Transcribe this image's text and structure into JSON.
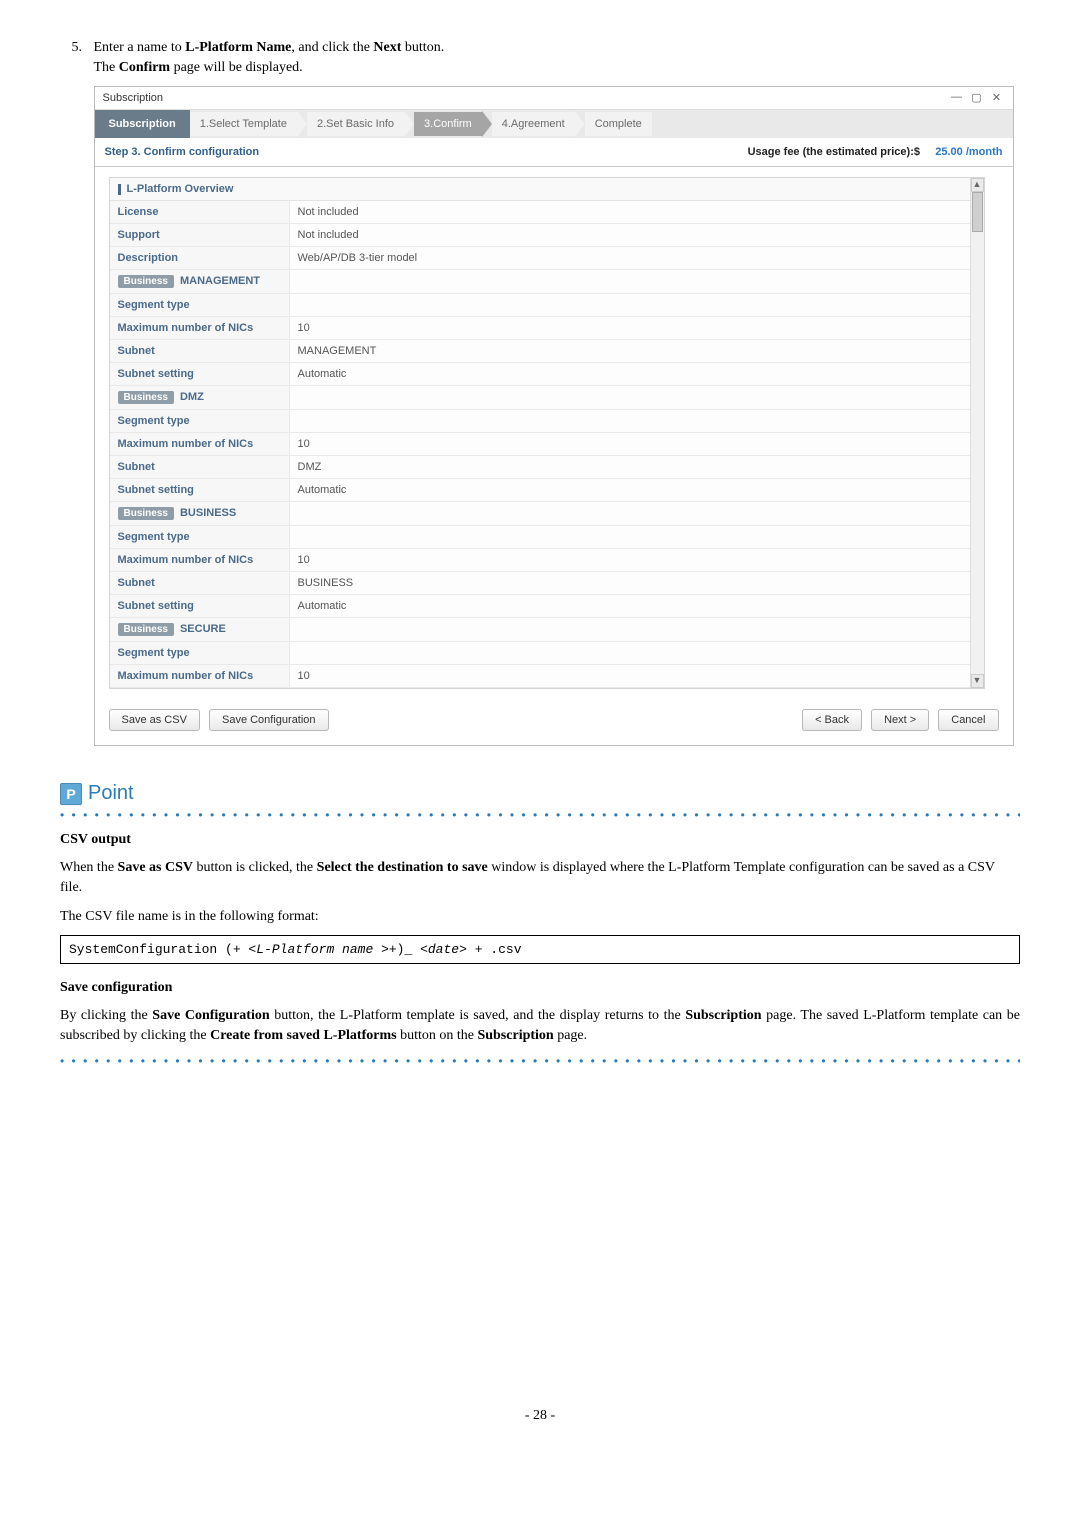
{
  "step": {
    "number": "5.",
    "line1_pre": "Enter a name to ",
    "line1_bold1": "L-Platform Name",
    "line1_mid": ", and click the ",
    "line1_bold2": "Next",
    "line1_post": " button.",
    "line2_pre": "The ",
    "line2_bold": "Confirm",
    "line2_post": " page will be displayed."
  },
  "screenshot": {
    "window_title": "Subscription",
    "win_min": "—",
    "win_max": "▢",
    "win_close": "✕",
    "left_tab": "Subscription",
    "crumbs": [
      "1.Select Template",
      "2.Set Basic Info",
      "3.Confirm",
      "4.Agreement",
      "Complete"
    ],
    "active_crumb_index": 2,
    "step_label": "Step 3. Confirm configuration",
    "usage_label": "Usage fee (the estimated price):$",
    "usage_value": "25.00 /month",
    "overview_header": "L-Platform Overview",
    "overview_rows": [
      {
        "label": "License",
        "value": "Not included"
      },
      {
        "label": "Support",
        "value": "Not included"
      },
      {
        "label": "Description",
        "value": "Web/AP/DB 3-tier model"
      }
    ],
    "badge_text": "Business",
    "segments": [
      {
        "name": "MANAGEMENT",
        "rows": [
          {
            "label": "Segment type",
            "value": ""
          },
          {
            "label": "Maximum number of NICs",
            "value": "10"
          },
          {
            "label": "Subnet",
            "value": "MANAGEMENT"
          },
          {
            "label": "Subnet setting",
            "value": "Automatic"
          }
        ]
      },
      {
        "name": "DMZ",
        "rows": [
          {
            "label": "Segment type",
            "value": ""
          },
          {
            "label": "Maximum number of NICs",
            "value": "10"
          },
          {
            "label": "Subnet",
            "value": "DMZ"
          },
          {
            "label": "Subnet setting",
            "value": "Automatic"
          }
        ]
      },
      {
        "name": "BUSINESS",
        "rows": [
          {
            "label": "Segment type",
            "value": ""
          },
          {
            "label": "Maximum number of NICs",
            "value": "10"
          },
          {
            "label": "Subnet",
            "value": "BUSINESS"
          },
          {
            "label": "Subnet setting",
            "value": "Automatic"
          }
        ]
      },
      {
        "name": "SECURE",
        "rows": [
          {
            "label": "Segment type",
            "value": ""
          },
          {
            "label": "Maximum number of NICs",
            "value": "10"
          }
        ]
      }
    ],
    "buttons": {
      "save_csv": "Save as CSV",
      "save_config": "Save Configuration",
      "back": "< Back",
      "next": "Next >",
      "cancel": "Cancel"
    }
  },
  "point": {
    "icon_glyph": "P",
    "title": "Point",
    "dots": "• • • • • • • • • • • • • • • • • • • • • • • • • • • • • • • • • • • • • • • • • • • • • • • • • • • • • • • • • • • • • • • • • • • • • • • • • • • • • • • • • • • • • • • • • • • • • • • • • • • •",
    "csv_header": "CSV output",
    "csv_p1_pre": "When the ",
    "csv_p1_b1": "Save as CSV",
    "csv_p1_mid": " button is clicked, the ",
    "csv_p1_b2": "Select the destination to save",
    "csv_p1_post": " window is displayed where the L-Platform Template configuration can be saved as a CSV file.",
    "csv_p2": "The CSV file name is in the following format:",
    "code_pre": "SystemConfiguration (+ <",
    "code_it1": "L-Platform name ",
    "code_mid": ">+)_ <",
    "code_it2": "date",
    "code_post": "> + .csv",
    "savecfg_header": "Save configuration",
    "sc_p_pre": "By clicking the ",
    "sc_p_b1": "Save Configuration",
    "sc_p_mid1": " button, the L-Platform template is saved, and the display returns to the ",
    "sc_p_b2": "Subscription",
    "sc_p_mid2": " page. The saved L-Platform template can be subscribed by clicking the ",
    "sc_p_b3": "Create from saved L-Platforms",
    "sc_p_mid3": " button on the ",
    "sc_p_b4": "Subscription",
    "sc_p_post": " page."
  },
  "page_number": "- 28 -"
}
